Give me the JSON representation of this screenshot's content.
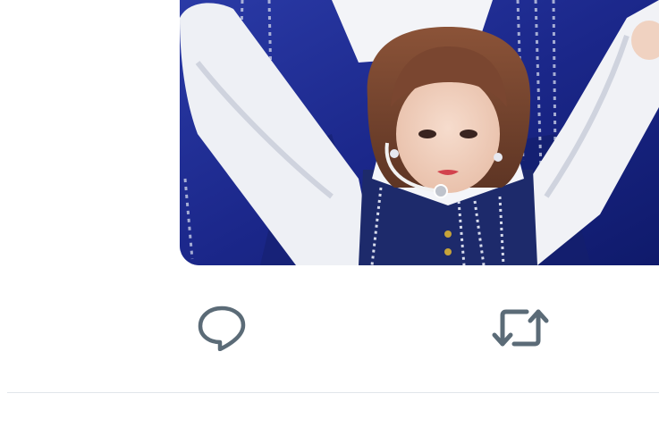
{
  "tweet": {
    "media": {
      "type": "photo",
      "icon": "photo-image",
      "colors": {
        "background": "#1f2d8a",
        "shirt": "#f2f3f7",
        "hair": "#7a4a33",
        "vest": "#1d2a6b"
      }
    },
    "actions": [
      {
        "name": "reply",
        "icon": "reply-bubble-icon"
      },
      {
        "name": "retweet",
        "icon": "retweet-arrows-icon"
      }
    ],
    "icon_color": "#5b6b77",
    "divider_color": "#e1e6ea"
  }
}
